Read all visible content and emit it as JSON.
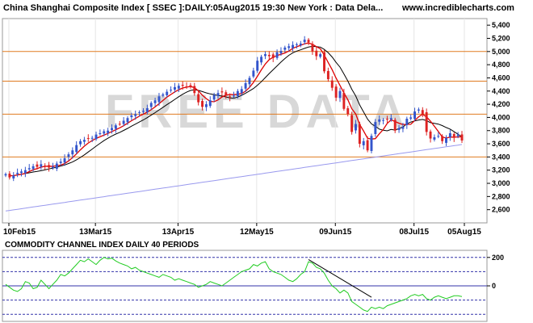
{
  "header": {
    "title": "China Shanghai Composite Index [ SSEC ]:DAILY:05Aug2015 19:30 New York : Data Dela...",
    "site": "www.incrediblecharts.com"
  },
  "watermark": "FREE DATA",
  "colors": {
    "up_candle": "#3355cc",
    "down_candle": "#dd2222",
    "fast_ma": "#dd0000",
    "slow_ma": "#000000",
    "long_ma": "#9999ee",
    "support_lines": "#e07b20",
    "cci_line": "#22cc22",
    "cci_ref": "#3333aa",
    "trendline": "#000000"
  },
  "chart_data": [
    {
      "type": "candlestick",
      "title": "China Shanghai Composite Index [ SSEC ]:DAILY:05Aug2015 19:30 New York : Data Dela...",
      "ylim": [
        2400,
        5500
      ],
      "y_ticks": [
        "2,600",
        "2,800",
        "3,000",
        "3,200",
        "3,400",
        "3,600",
        "3,800",
        "4,000",
        "4,200",
        "4,400",
        "4,600",
        "4,800",
        "5,000",
        "5,200",
        "5,400"
      ],
      "x_tick_labels": [
        "10Feb15",
        "13Mar15",
        "13Apr15",
        "12May15",
        "09Jun15",
        "08Jul15",
        "05Aug15"
      ],
      "horizontal_levels": [
        3400,
        4050,
        4550,
        5000
      ],
      "closes": [
        3140,
        3090,
        3120,
        3160,
        3180,
        3200,
        3230,
        3260,
        3250,
        3290,
        3260,
        3240,
        3250,
        3300,
        3330,
        3380,
        3440,
        3500,
        3580,
        3640,
        3660,
        3680,
        3690,
        3740,
        3760,
        3790,
        3800,
        3840,
        3880,
        3900,
        3950,
        3990,
        4030,
        4050,
        4080,
        4100,
        4140,
        4220,
        4260,
        4320,
        4350,
        4390,
        4420,
        4460,
        4480,
        4480,
        4460,
        4470,
        4370,
        4230,
        4160,
        4200,
        4260,
        4340,
        4370,
        4380,
        4340,
        4310,
        4330,
        4400,
        4430,
        4520,
        4600,
        4710,
        4860,
        4920,
        4960,
        4930,
        4900,
        4990,
        5010,
        5060,
        5080,
        5100,
        5110,
        5120,
        5180,
        5140,
        5000,
        4930,
        4960,
        4700,
        4580,
        4450,
        4300,
        4400,
        4130,
        4050,
        3780,
        3900,
        3600,
        3640,
        3500,
        3720,
        3930,
        3970,
        3960,
        3970,
        3990,
        3800,
        3840,
        3860,
        3980,
        4000,
        4090,
        4120,
        4050,
        3780,
        3680,
        3700,
        3720,
        3640,
        3690,
        3760,
        3690,
        3740,
        3650
      ]
    },
    {
      "type": "line",
      "title": "COMMODITY CHANNEL INDEX DAILY 40 PERIODS",
      "ylim": [
        -250,
        250
      ],
      "y_ticks": [
        "200",
        "0"
      ],
      "reference_levels": [
        200,
        100,
        0,
        -100,
        -200
      ],
      "values": [
        10,
        -10,
        -30,
        -40,
        -20,
        30,
        20,
        -20,
        -10,
        40,
        10,
        -20,
        10,
        40,
        80,
        70,
        90,
        120,
        150,
        180,
        170,
        190,
        170,
        150,
        180,
        200,
        190,
        195,
        175,
        160,
        150,
        140,
        120,
        130,
        110,
        100,
        90,
        80,
        70,
        60,
        80,
        70,
        60,
        40,
        50,
        40,
        30,
        20,
        10,
        -10,
        0,
        10,
        30,
        20,
        10,
        0,
        20,
        40,
        60,
        80,
        100,
        110,
        120,
        150,
        140,
        160,
        170,
        120,
        100,
        90,
        80,
        60,
        40,
        30,
        50,
        80,
        100,
        170,
        160,
        130,
        120,
        90,
        40,
        0,
        -20,
        -50,
        -30,
        -50,
        -110,
        -130,
        -150,
        -170,
        -180,
        -150,
        -160,
        -150,
        -160,
        -140,
        -130,
        -120,
        -110,
        -100,
        -90,
        -70,
        -60,
        -70,
        -60,
        -90,
        -100,
        -80,
        -70,
        -80,
        -90,
        -80,
        -70,
        -70,
        -75
      ]
    }
  ]
}
